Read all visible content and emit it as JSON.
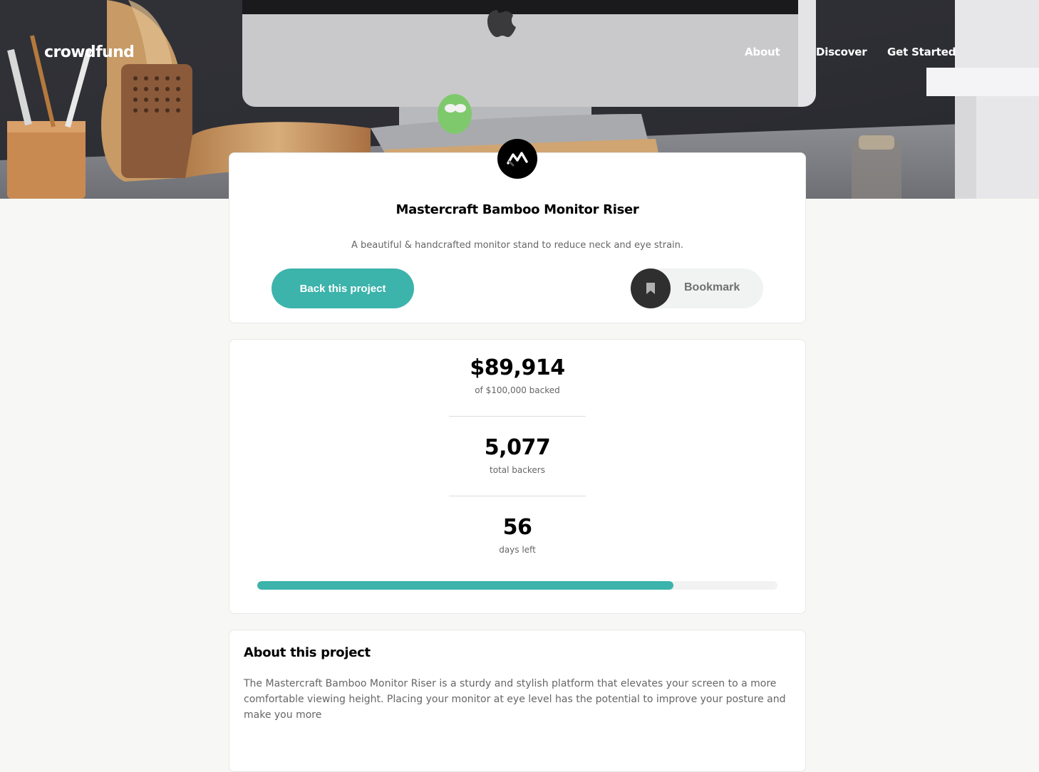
{
  "header": {
    "logo": "crowdfund",
    "nav": {
      "about": "About",
      "discover": "Discover",
      "get_started": "Get Started"
    }
  },
  "hero": {
    "image_icon": "desk-monitor-photo"
  },
  "project": {
    "logo_icon": "mastercraft-logo-icon",
    "title": "Mastercraft Bamboo Monitor Riser",
    "subtitle": "A beautiful & handcrafted monitor stand to reduce neck and eye strain.",
    "back_label": "Back this project",
    "bookmark_label": "Bookmark",
    "bookmark_icon": "bookmark-icon"
  },
  "stats": {
    "backed_amount": "$89,914",
    "backed_label": "of $100,000 backed",
    "backers": "5,077",
    "backers_label": "total backers",
    "days": "56",
    "days_label": "days left",
    "progress": 0.8
  },
  "about": {
    "heading": "About this project",
    "text": "The Mastercraft Bamboo Monitor Riser is a sturdy and stylish platform that elevates your screen to a more comfortable viewing height. Placing your monitor at eye level has the potential to improve your posture and make you more"
  },
  "colors": {
    "accent": "#3cb3ab",
    "dark": "#2f2f2f",
    "muted": "#707070"
  }
}
